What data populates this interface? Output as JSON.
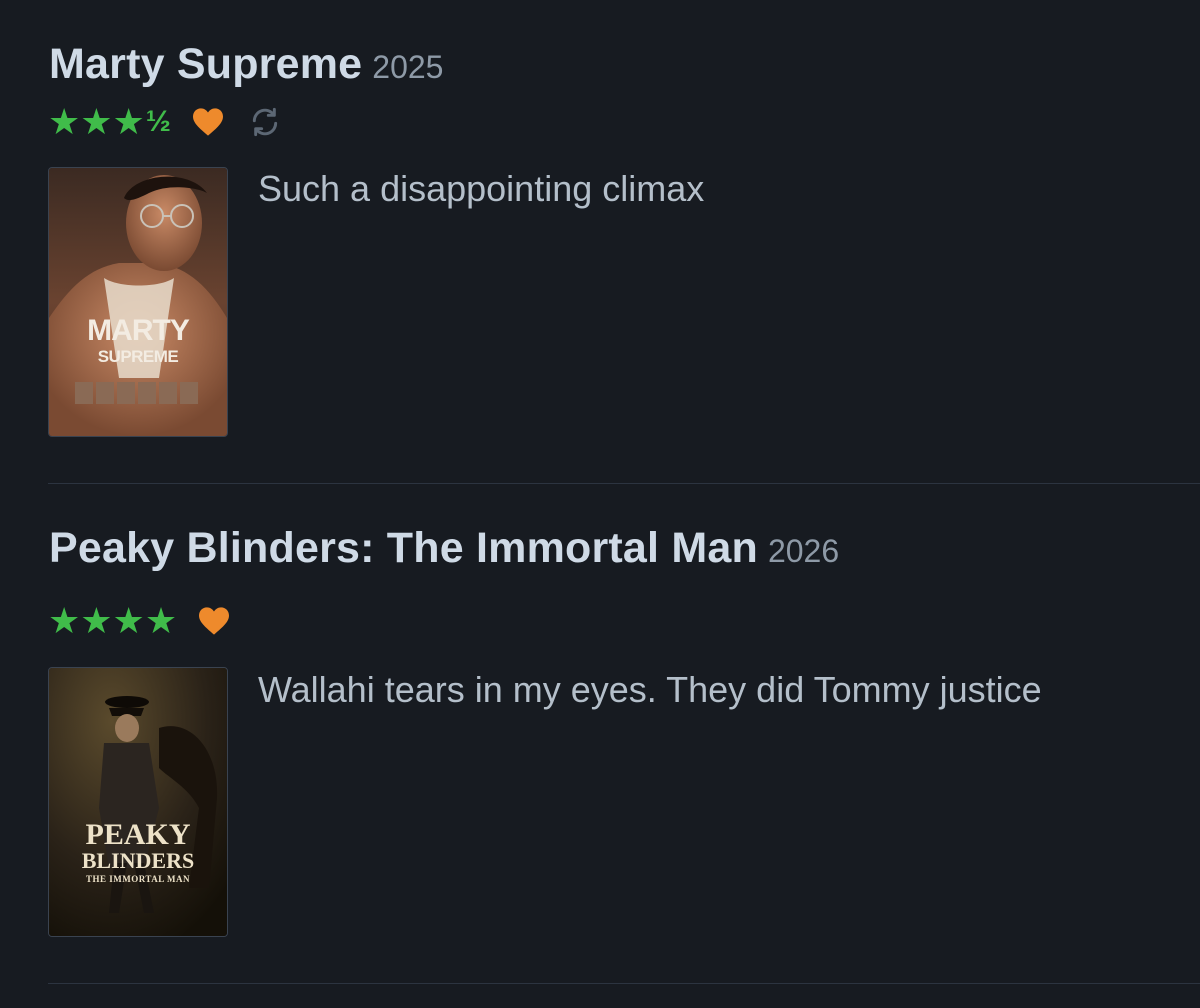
{
  "entries": [
    {
      "title": "Marty Supreme",
      "year": "2025",
      "rating_stars": 3.5,
      "stars_glyph": "★★★",
      "half_glyph": "½",
      "liked": true,
      "rewatch": true,
      "review": "Such a disappointing climax",
      "poster": {
        "line1": "MARTY",
        "line2": "SUPREME"
      }
    },
    {
      "title": "Peaky Blinders: The Immortal Man",
      "year": "2026",
      "rating_stars": 4,
      "stars_glyph": "★★★★",
      "liked": true,
      "rewatch": false,
      "review": "Wallahi tears in my eyes. They did Tommy justice",
      "poster": {
        "line1": "PEAKY",
        "line2": "BLINDERS",
        "line3": "THE IMMORTAL MAN"
      }
    }
  ],
  "colors": {
    "background": "#171b21",
    "star": "#40bc4a",
    "heart": "#ee8a2c",
    "rewatch_icon": "#5c6774"
  },
  "icons": [
    "star-icon",
    "half-star-icon",
    "heart-icon",
    "rewatch-icon"
  ]
}
